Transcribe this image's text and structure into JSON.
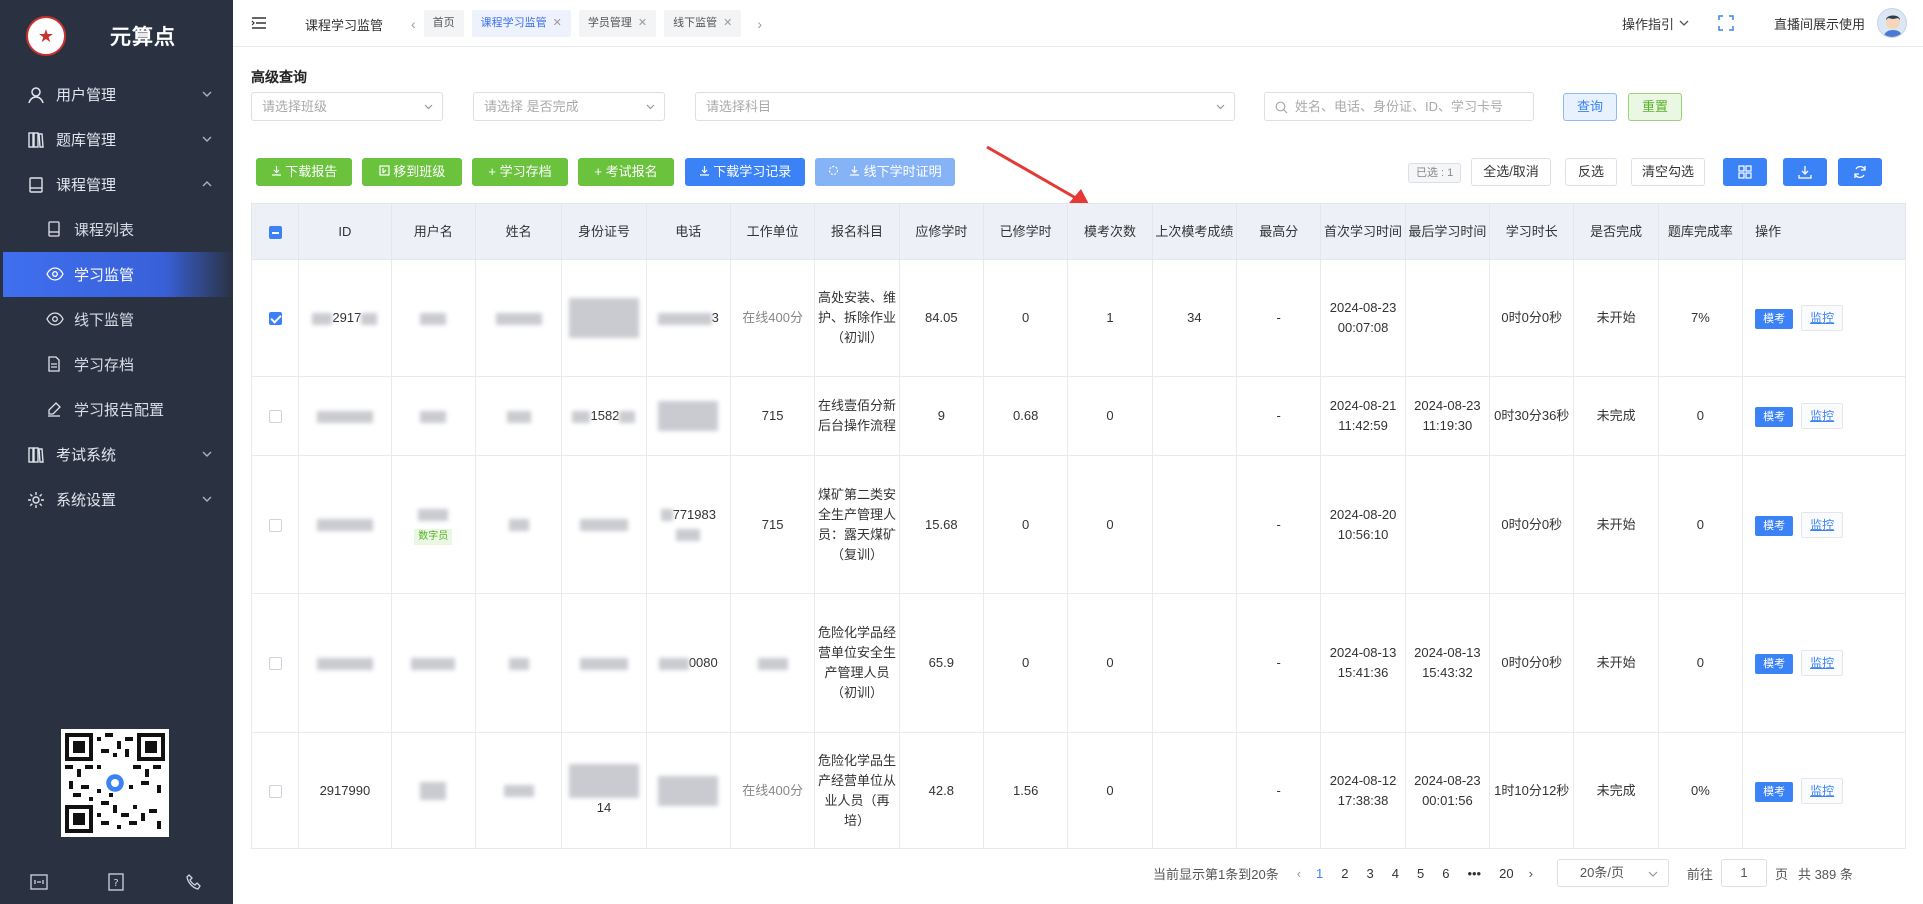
{
  "sidebar": {
    "logo_text": "元算点",
    "menu": [
      {
        "label": "用户管理"
      },
      {
        "label": "题库管理"
      },
      {
        "label": "课程管理"
      },
      {
        "label": "考试系统"
      },
      {
        "label": "系统设置"
      }
    ],
    "sub": [
      {
        "label": "课程列表"
      },
      {
        "label": "学习监管"
      },
      {
        "label": "线下监管"
      },
      {
        "label": "学习存档"
      },
      {
        "label": "学习报告配置"
      }
    ]
  },
  "topbar": {
    "breadcrumb": "课程学习监管",
    "tabs": [
      {
        "label": "首页"
      },
      {
        "label": "课程学习监管"
      },
      {
        "label": "学员管理"
      },
      {
        "label": "线下监管"
      }
    ],
    "guide": "操作指引",
    "user": "直播间展示使用"
  },
  "filters": {
    "title": "高级查询",
    "class_placeholder": "请选择班级",
    "completed_placeholder": "请选择 是否完成",
    "subject_placeholder": "请选择科目",
    "search_placeholder": "姓名、电话、身份证、ID、学习卡号",
    "query": "查询",
    "reset": "重置"
  },
  "toolbar": {
    "download_report": "下载报告",
    "move_class": "移到班级",
    "study_archive": "+ 学习存档",
    "exam_signup": "+ 考试报名",
    "download_records": "下载学习记录",
    "download_offline": "线下学时证明",
    "selected": "已选 : 1",
    "select_all": "全选/取消",
    "invert": "反选",
    "clear": "清空勾选"
  },
  "table": {
    "headers": [
      "ID",
      "用户名",
      "姓名",
      "身份证号",
      "电话",
      "工作单位",
      "报名科目",
      "应修学时",
      "已修学时",
      "模考次数",
      "上次模考成绩",
      "最高分",
      "首次学习时间",
      "最后学习时间",
      "学习时长",
      "是否完成",
      "题库完成率",
      "操作"
    ],
    "rows": [
      {
        "id": "2917",
        "phone": "3",
        "unit": "在线400分",
        "subject": "高处安装、维护、拆除作业（初训）",
        "required": "84.05",
        "done": "0",
        "mock_count": "1",
        "last_score": "34",
        "max": "-",
        "first": "2024-08-23 00:07:08",
        "last": "",
        "duration": "0时0分0秒",
        "finished": "未开始",
        "rate": "7%",
        "checked": true
      },
      {
        "id": "",
        "phone": "",
        "idcard": "1582",
        "unit": "715",
        "subject": "在线壹佰分新后台操作流程",
        "required": "9",
        "done": "0.68",
        "mock_count": "0",
        "last_score": "",
        "max": "-",
        "first": "2024-08-21 11:42:59",
        "last": "2024-08-23 11:19:30",
        "duration": "0时30分36秒",
        "finished": "未完成",
        "rate": "0",
        "checked": false
      },
      {
        "id": "",
        "phone": "771983",
        "tag": "数字员",
        "unit": "715",
        "subject": "煤矿第二类安全生产管理人员：露天煤矿（复训）",
        "required": "15.68",
        "done": "0",
        "mock_count": "0",
        "last_score": "",
        "max": "-",
        "first": "2024-08-20 10:56:10",
        "last": "",
        "duration": "0时0分0秒",
        "finished": "未开始",
        "rate": "0",
        "checked": false
      },
      {
        "id": "",
        "phone": "0080",
        "unit": "",
        "subject": "危险化学品经营单位安全生产管理人员（初训）",
        "required": "65.9",
        "done": "0",
        "mock_count": "0",
        "last_score": "",
        "max": "-",
        "first": "2024-08-13 15:41:36",
        "last": "2024-08-13 15:43:32",
        "duration": "0时0分0秒",
        "finished": "未开始",
        "rate": "0",
        "checked": false
      },
      {
        "id": "2917990",
        "phone": "",
        "idcard_tail": "14",
        "unit": "在线400分",
        "subject": "危险化学品生产经营单位从业人员（再培）",
        "required": "42.8",
        "done": "1.56",
        "mock_count": "0",
        "last_score": "",
        "max": "-",
        "first": "2024-08-12 17:38:38",
        "last": "2024-08-23 00:01:56",
        "duration": "1时10分12秒",
        "finished": "未完成",
        "rate": "0%",
        "checked": false
      }
    ],
    "op_mock": "模考",
    "op_monitor": "监控"
  },
  "pager": {
    "info": "当前显示第1条到20条",
    "pages": [
      "1",
      "2",
      "3",
      "4",
      "5",
      "6",
      "20"
    ],
    "ellipsis": "•••",
    "size": "20条/页",
    "goto_label": "前往",
    "goto_value": "1",
    "page_label": "页",
    "total": "共 389 条"
  },
  "colors": {
    "accent": "#3b82f6",
    "green": "#6bc23d",
    "sidebar": "#2a3242",
    "arrow": "#e53935"
  }
}
